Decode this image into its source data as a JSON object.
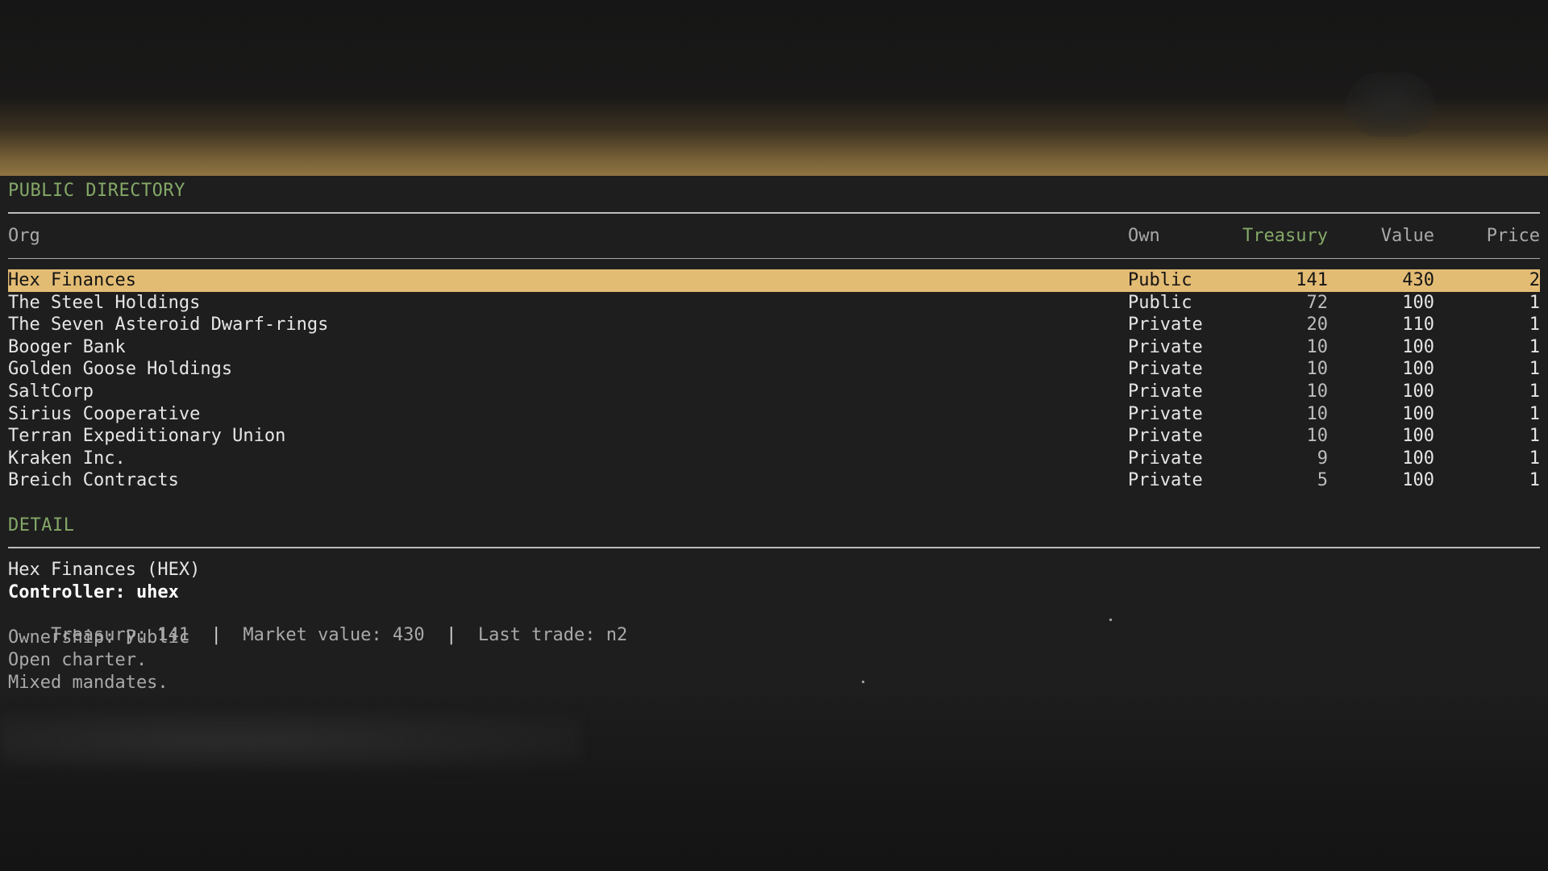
{
  "directory": {
    "title": "PUBLIC DIRECTORY",
    "columns": {
      "org": "Org",
      "own": "Own",
      "treasury": "Treasury",
      "value": "Value",
      "price": "Price"
    },
    "rows": [
      {
        "org": "Hex Finances",
        "own": "Public",
        "treasury": "141",
        "value": "430",
        "price": "2"
      },
      {
        "org": "The Steel Holdings",
        "own": "Public",
        "treasury": "72",
        "value": "100",
        "price": "1"
      },
      {
        "org": "The Seven Asteroid Dwarf-rings",
        "own": "Private",
        "treasury": "20",
        "value": "110",
        "price": "1"
      },
      {
        "org": "Booger Bank",
        "own": "Private",
        "treasury": "10",
        "value": "100",
        "price": "1"
      },
      {
        "org": "Golden Goose Holdings",
        "own": "Private",
        "treasury": "10",
        "value": "100",
        "price": "1"
      },
      {
        "org": "SaltCorp",
        "own": "Private",
        "treasury": "10",
        "value": "100",
        "price": "1"
      },
      {
        "org": "Sirius Cooperative",
        "own": "Private",
        "treasury": "10",
        "value": "100",
        "price": "1"
      },
      {
        "org": "Terran Expeditionary Union",
        "own": "Private",
        "treasury": "10",
        "value": "100",
        "price": "1"
      },
      {
        "org": "Kraken Inc.",
        "own": "Private",
        "treasury": "9",
        "value": "100",
        "price": "1"
      },
      {
        "org": "Breich Contracts",
        "own": "Private",
        "treasury": "5",
        "value": "100",
        "price": "1"
      }
    ]
  },
  "detail": {
    "title": "DETAIL",
    "name": "Hex Finances (HEX)",
    "controller": "Controller: uhex",
    "treasury": "Treasury: 141",
    "market_value": "Market value: 430",
    "last_trade": "Last trade: n2",
    "separator": "|",
    "ownership": "Ownership: Public",
    "charter": "Open charter.",
    "mandates": "Mixed mandates."
  },
  "colors": {
    "accent_green": "#84a868",
    "selection": "#e3bc74",
    "panel_bg": "#1e1e1e"
  }
}
